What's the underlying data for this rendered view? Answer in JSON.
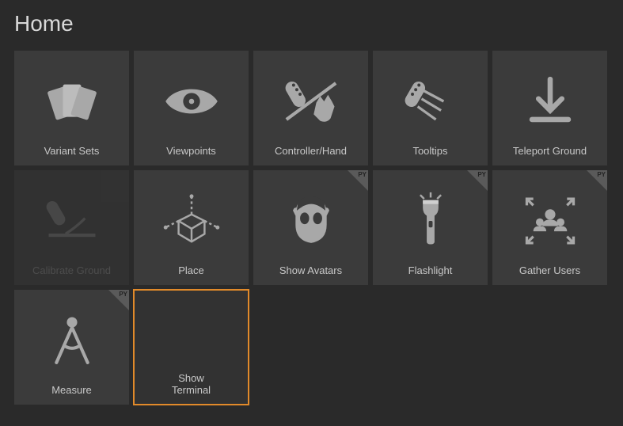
{
  "title": "Home",
  "py_tag": "PY",
  "tiles": [
    {
      "id": "variant-sets",
      "label": "Variant Sets",
      "py": false,
      "dim": false,
      "selected": false
    },
    {
      "id": "viewpoints",
      "label": "Viewpoints",
      "py": false,
      "dim": false,
      "selected": false
    },
    {
      "id": "controller-hand",
      "label": "Controller/Hand",
      "py": false,
      "dim": false,
      "selected": false
    },
    {
      "id": "tooltips",
      "label": "Tooltips",
      "py": false,
      "dim": false,
      "selected": false
    },
    {
      "id": "teleport-ground",
      "label": "Teleport Ground",
      "py": false,
      "dim": false,
      "selected": false
    },
    {
      "id": "calibrate-ground",
      "label": "Calibrate Ground",
      "py": false,
      "dim": true,
      "selected": false
    },
    {
      "id": "place",
      "label": "Place",
      "py": false,
      "dim": false,
      "selected": false
    },
    {
      "id": "show-avatars",
      "label": "Show Avatars",
      "py": true,
      "dim": false,
      "selected": false
    },
    {
      "id": "flashlight",
      "label": "Flashlight",
      "py": true,
      "dim": false,
      "selected": false
    },
    {
      "id": "gather-users",
      "label": "Gather Users",
      "py": true,
      "dim": false,
      "selected": false
    },
    {
      "id": "measure",
      "label": "Measure",
      "py": true,
      "dim": false,
      "selected": false
    },
    {
      "id": "show-terminal",
      "label": "Show\nTerminal",
      "py": false,
      "dim": false,
      "selected": true
    }
  ]
}
